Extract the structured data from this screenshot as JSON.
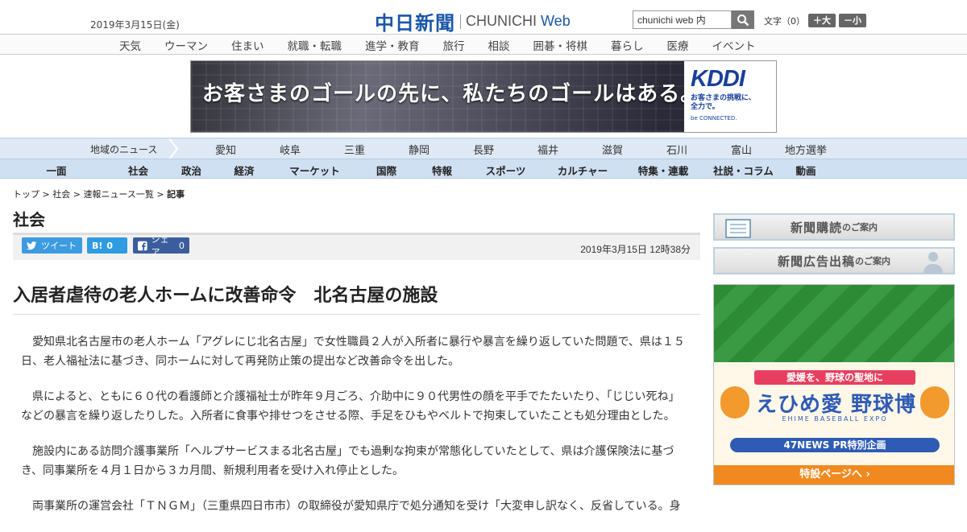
{
  "header": {
    "date": "2019年3月15日(金)",
    "logo_kanji": "中日新聞",
    "logo_en": "CHUNICHI",
    "logo_web": "Web",
    "search_value": "chunichi web 内",
    "font_size_label": "文字（0）",
    "font_larger": "＋大",
    "font_smaller": "－小"
  },
  "global_nav": [
    "天気",
    "ウーマン",
    "住まい",
    "就職・転職",
    "進学・教育",
    "旅行",
    "相談",
    "囲碁・将棋",
    "暮らし",
    "医療",
    "イベント"
  ],
  "banner_ad": {
    "copy": "お客さまのゴールの先に、私たちのゴールはある。",
    "brand": "KDDI",
    "tagline_1": "お客さまの挑戦に、",
    "tagline_2": "全力で。",
    "sub": "be CONNECTED."
  },
  "region_nav": {
    "title": "地域のニュース",
    "items": [
      "愛知",
      "岐阜",
      "三重",
      "静岡",
      "長野",
      "福井",
      "滋賀",
      "石川",
      "富山",
      "地方選挙"
    ]
  },
  "category_nav": [
    "一面",
    "社会",
    "政治",
    "経済",
    "マーケット",
    "国際",
    "特報",
    "スポーツ",
    "カルチャー",
    "特集・連載",
    "社説・コラム",
    "動画"
  ],
  "breadcrumb": {
    "top": "トップ",
    "section": "社会",
    "list": "速報ニュース一覧",
    "current": "記事",
    "sep": ">"
  },
  "section_title": "社会",
  "share": {
    "tweet": "ツイート",
    "hatena_label": "B!",
    "hatena_count": "0",
    "fb_label": "シェア",
    "fb_count": "0",
    "published": "2019年3月15日 12時38分"
  },
  "article": {
    "headline": "入居者虐待の老人ホームに改善命令　北名古屋の施設",
    "paragraphs": [
      "愛知県北名古屋市の老人ホーム「アグレにじ北名古屋」で女性職員２人が入所者に暴行や暴言を繰り返していた問題で、県は１５日、老人福祉法に基づき、同ホームに対して再発防止策の提出など改善命令を出した。",
      "県によると、ともに６０代の看護師と介護福祉士が昨年９月ごろ、介助中に９０代男性の顔を平手でたたいたり、「じじい死ね」などの暴言を繰り返したりした。入所者に食事や排せつをさせる際、手足をひもやベルトで拘束していたことも処分理由とした。",
      "施設内にある訪問介護事業所「ヘルプサービスまる北名古屋」でも過剰な拘束が常態化していたとして、県は介護保険法に基づき、同事業所を４月１日から３カ月間、新規利用者を受け入れ停止とした。",
      "両事業所の運営会社「ＴＮＧＭ」（三重県四日市市）の取締役が愛知県庁で処分通知を受け「大変申し訳なく、反省している。身"
    ]
  },
  "sidebar": {
    "subscribe_main": "新聞購読",
    "subscribe_small": "のご案内",
    "ad_main": "新聞広告出稿",
    "ad_small": "のご案内"
  },
  "side_ad": {
    "lead": "愛媛を、野球の聖地に",
    "title": "えひめ愛 野球博",
    "sub": "EHIME BASEBALL EXPO",
    "pr": "47NEWS PR特別企画",
    "cta": "特設ページへ ›"
  },
  "colors": {
    "brand_blue": "#1a56a8",
    "nav_region_bg": "#dfe9f5",
    "nav_category_bg": "#d0e0f3",
    "twitter": "#3d9be0",
    "hatena": "#2f9be0",
    "facebook": "#3c5d9c",
    "kddi_blue": "#1a3f9c",
    "ad_cta_orange": "#f08a20"
  }
}
